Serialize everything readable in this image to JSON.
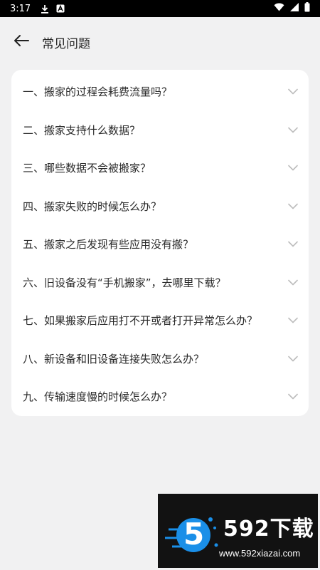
{
  "status_bar": {
    "time": "3:17",
    "icons": [
      "download-icon",
      "a-notification-icon",
      "wifi-icon",
      "signal-icon",
      "battery-icon"
    ]
  },
  "header": {
    "back_icon": "arrow-left-icon",
    "title": "常见问题"
  },
  "faq": {
    "items": [
      {
        "label": "一、搬家的过程会耗费流量吗？"
      },
      {
        "label": "二、搬家支持什么数据？"
      },
      {
        "label": "三、哪些数据不会被搬家？"
      },
      {
        "label": "四、搬家失败的时候怎么办？"
      },
      {
        "label": "五、搬家之后发现有些应用没有搬？"
      },
      {
        "label": "六、旧设备没有“手机搬家”，去哪里下载？"
      },
      {
        "label": "七、如果搬家后应用打不开或者打开异常怎么办？"
      },
      {
        "label": "八、新设备和旧设备连接失败怎么办？"
      },
      {
        "label": "九、传输速度慢的时候怎么办？"
      }
    ],
    "chevron_icon": "chevron-down-icon"
  },
  "watermark": {
    "logo_text": "5",
    "brand": "592下载",
    "url": "www.592xiazai.com"
  },
  "colors": {
    "background": "#f1f1f2",
    "card": "#ffffff",
    "text": "#2a2a2a",
    "chevron": "#bdbdbd",
    "accent": "#1a8fe8"
  }
}
